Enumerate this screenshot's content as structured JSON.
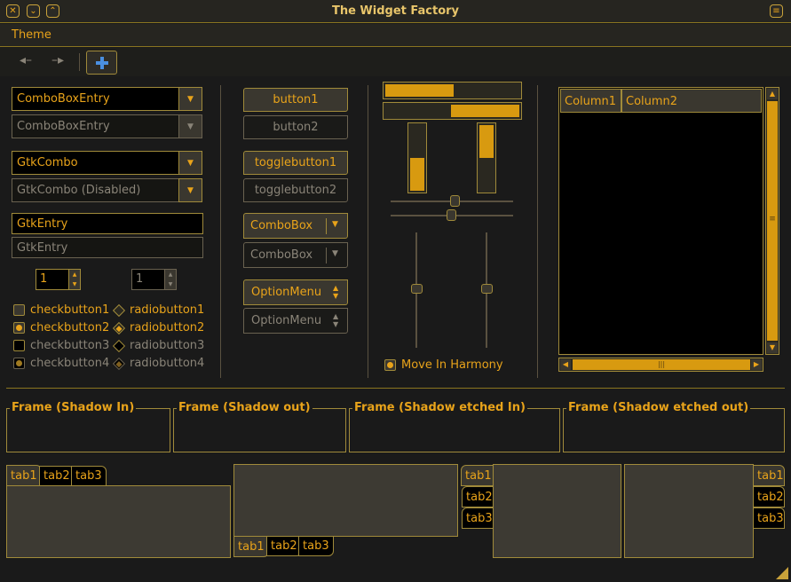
{
  "window": {
    "title": "The Widget Factory"
  },
  "menu": {
    "theme_label": "Theme"
  },
  "toolbar": {
    "back_icon": "back-arrow-icon",
    "forward_icon": "forward-arrow-icon",
    "add_icon": "plus-icon"
  },
  "left": {
    "combo_entry_1": "ComboBoxEntry",
    "combo_entry_2": "ComboBoxEntry",
    "gtk_combo_1": "GtkCombo",
    "gtk_combo_2": "GtkCombo (Disabled)",
    "entry_1": "GtkEntry",
    "entry_2": "GtkEntry",
    "spin_1": "1",
    "spin_2": "1",
    "checks": [
      "checkbutton1",
      "checkbutton2",
      "checkbutton3",
      "checkbutton4"
    ],
    "radios": [
      "radiobutton1",
      "radiobutton2",
      "radiobutton3",
      "radiobutton4"
    ]
  },
  "middle": {
    "button1": "button1",
    "button2": "button2",
    "toggle1": "togglebutton1",
    "toggle2": "togglebutton2",
    "combobox1": "ComboBox",
    "combobox2": "ComboBox",
    "optionmenu1": "OptionMenu",
    "optionmenu2": "OptionMenu"
  },
  "progress": {
    "hbar1": 0.5,
    "hbar2": 0.5,
    "vbar1": 0.5,
    "vbar2": 0.5,
    "move_in_harmony": "Move In Harmony"
  },
  "tree": {
    "columns": [
      "Column1",
      "Column2"
    ]
  },
  "frames": [
    "Frame (Shadow In)",
    "Frame (Shadow out)",
    "Frame (Shadow etched In)",
    "Frame (Shadow etched out)"
  ],
  "notebooks": {
    "tabs": [
      "tab1",
      "tab2",
      "tab3"
    ]
  }
}
